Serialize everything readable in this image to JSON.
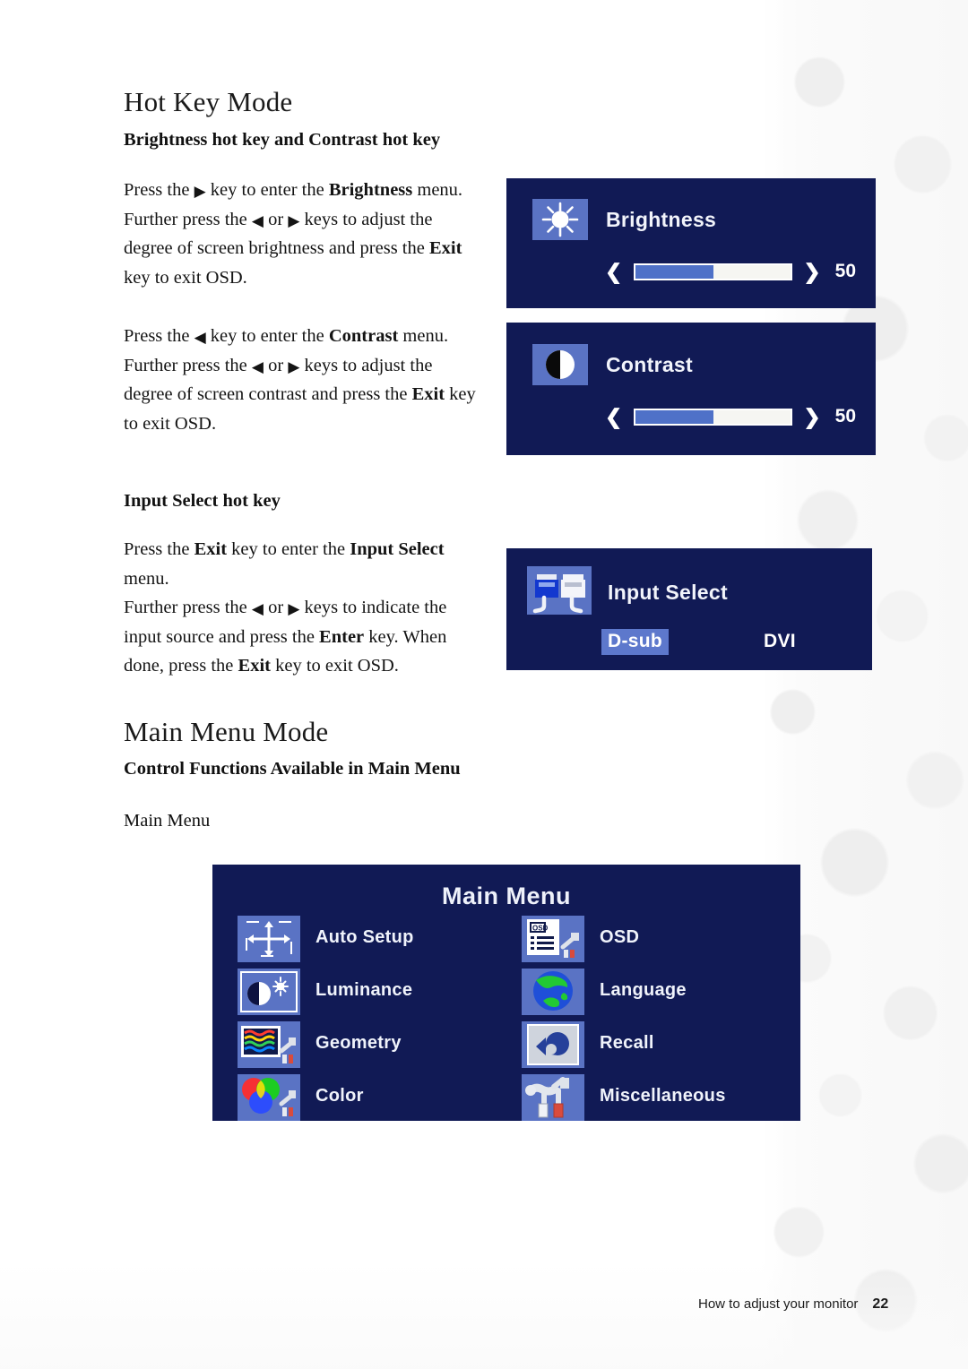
{
  "page": {
    "footer_text": "How to adjust your monitor",
    "page_number": "22"
  },
  "sections": {
    "hotkey": {
      "title": "Hot Key Mode",
      "sub1": "Brightness hot key and Contrast hot key",
      "sub2": "Input Select hot key",
      "brightness_para": {
        "l1a": "Press the ",
        "l1_icon": "▶",
        "l1b": " key to enter the ",
        "l1_bold": "Brightness",
        "l1c": " menu.",
        "l2a": "Further press the ",
        "l2_icon1": "◀",
        "l2b": " or ",
        "l2_icon2": "▶",
        "l2c": " keys to adjust the",
        "l3a": "degree of screen brightness and press the ",
        "l3_bold": "Exit",
        "l4": "key to exit OSD."
      },
      "contrast_para": {
        "l1a": "Press the ",
        "l1_icon": "◀",
        "l1b": " key to enter the ",
        "l1_bold": "Contrast",
        "l1c": " menu.",
        "l2a": "Further press the ",
        "l2_icon1": "◀",
        "l2b": " or ",
        "l2_icon2": "▶",
        "l2c": " keys to adjust the",
        "l3a": "degree of screen contrast and press the ",
        "l3_bold": "Exit",
        "l3c": " key",
        "l4": "to exit OSD."
      },
      "input_para": {
        "l1a": "Press the ",
        "l1_bold1": "Exit",
        "l1b": " key to enter the ",
        "l1_bold2": "Input Select",
        "l2": "menu.",
        "l3a": "Further press the ",
        "l3_icon1": "◀",
        "l3b": " or ",
        "l3_icon2": "▶",
        "l3c": " keys to indicate the",
        "l4a": "input source and press the ",
        "l4_bold": "Enter",
        "l4c": " key. When",
        "l5a": "done, press the ",
        "l5_bold": "Exit",
        "l5c": " key to exit OSD."
      }
    },
    "mainmenu": {
      "title": "Main Menu Mode",
      "sub1": "Control Functions Available in Main Menu",
      "sub2": "Main Menu"
    }
  },
  "osd": {
    "brightness": {
      "label": "Brightness",
      "icon": "sun-icon",
      "value": "50",
      "fill_percent": 50,
      "left_chevron": "❮",
      "right_chevron": "❯"
    },
    "contrast": {
      "label": "Contrast",
      "icon": "contrast-circle-icon",
      "value": "50",
      "fill_percent": 50,
      "left_chevron": "❮",
      "right_chevron": "❯"
    },
    "input_select": {
      "label": "Input Select",
      "icon": "connectors-icon",
      "option_selected": "D-sub",
      "option_other": "DVI"
    },
    "main_menu": {
      "title": "Main Menu",
      "left_items": [
        {
          "label": "Auto Setup",
          "icon": "auto-setup-icon"
        },
        {
          "label": "Luminance",
          "icon": "luminance-icon"
        },
        {
          "label": "Geometry",
          "icon": "geometry-icon"
        },
        {
          "label": "Color",
          "icon": "color-icon"
        }
      ],
      "right_items": [
        {
          "label": "OSD",
          "icon": "osd-icon"
        },
        {
          "label": "Language",
          "icon": "language-globe-icon"
        },
        {
          "label": "Recall",
          "icon": "recall-arrow-icon"
        },
        {
          "label": "Miscellaneous",
          "icon": "miscellaneous-tools-icon"
        }
      ]
    }
  },
  "colors": {
    "osd_background": "#111a55",
    "icon_tile": "#5a73c4",
    "slider_fill": "#4f71c8",
    "slider_track": "#f6f6f2",
    "highlight": "#5d78cc"
  }
}
